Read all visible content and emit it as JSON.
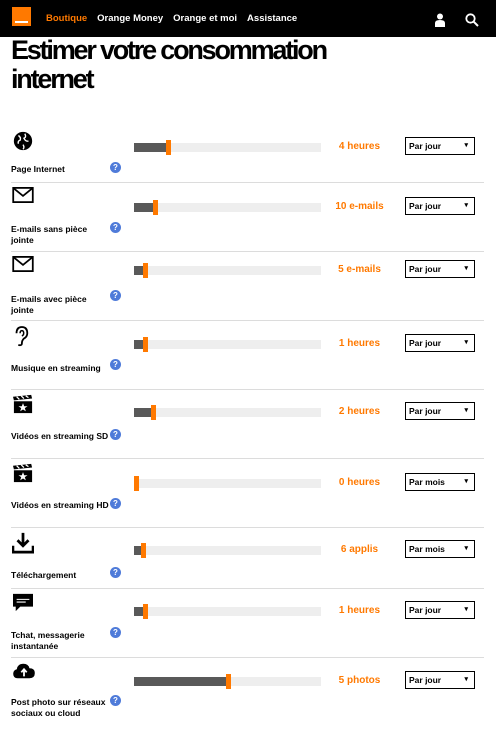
{
  "header": {
    "nav": [
      "Boutique",
      "Orange Money",
      "Orange et moi",
      "Assistance"
    ],
    "active_nav": "Boutique",
    "icons": [
      "orange-logo",
      "user-icon",
      "search-icon"
    ],
    "brand_color": "#ff7900"
  },
  "page": {
    "title": "Estimer votre consommation internet"
  },
  "help_symbol": "?",
  "rows": [
    {
      "label": "Page Internet",
      "icon": "globe-icon",
      "value": "4 heures",
      "period": "Par jour",
      "level": 0.17
    },
    {
      "label": "E-mails sans pièce jointe",
      "icon": "envelope-icon",
      "value": "10 e-mails",
      "period": "Par jour",
      "level": 0.1
    },
    {
      "label": "E-mails avec pièce jointe",
      "icon": "envelope-icon",
      "value": "5 e-mails",
      "period": "Par jour",
      "level": 0.05
    },
    {
      "label": "Musique en streaming",
      "icon": "ear-icon",
      "value": "1 heures",
      "period": "Par jour",
      "level": 0.05
    },
    {
      "label": "Vidéos en streaming SD",
      "icon": "clapperboard-icon",
      "value": "2 heures",
      "period": "Par jour",
      "level": 0.09
    },
    {
      "label": "Vidéos en streaming HD",
      "icon": "clapperboard-icon",
      "value": "0 heures",
      "period": "Par mois",
      "level": 0.0
    },
    {
      "label": "Téléchargement",
      "icon": "download-icon",
      "value": "6 applis",
      "period": "Par mois",
      "level": 0.04
    },
    {
      "label": "Tchat, messagerie instantanée",
      "icon": "chat-icon",
      "value": "1 heures",
      "period": "Par jour",
      "level": 0.05
    },
    {
      "label": "Post photo sur réseaux sociaux ou cloud",
      "icon": "cloud-upload-icon",
      "value": "5 photos",
      "period": "Par jour",
      "level": 0.49
    }
  ]
}
